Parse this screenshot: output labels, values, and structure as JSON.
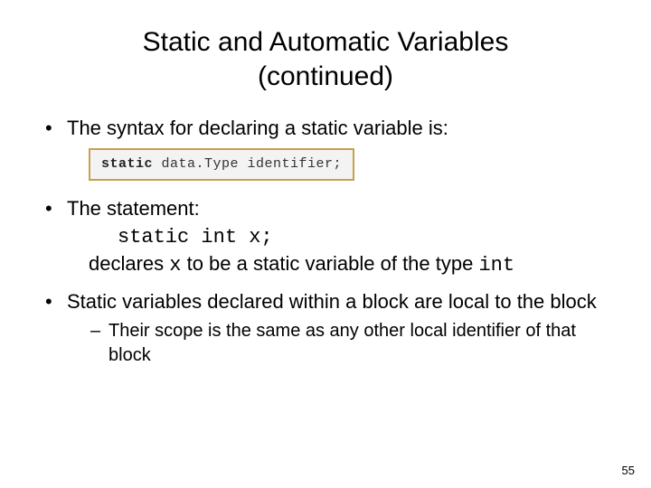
{
  "title_line1": "Static and Automatic Variables",
  "title_line2": "(continued)",
  "bullets": {
    "b1": "The syntax for declaring a static variable is:",
    "b2_lead": "The statement:",
    "b2_code": "static int x;",
    "b2_tail_a": "declares ",
    "b2_tail_code_x": "x",
    "b2_tail_b": " to be a static variable of the type ",
    "b2_tail_code_int": "int",
    "b3": "Static variables declared within a block are local to the block",
    "b3_sub": "Their scope is the same as any other local identifier of that block"
  },
  "syntax_box": {
    "kw": "static",
    "rest": " data.Type identifier;"
  },
  "page_number": "55"
}
